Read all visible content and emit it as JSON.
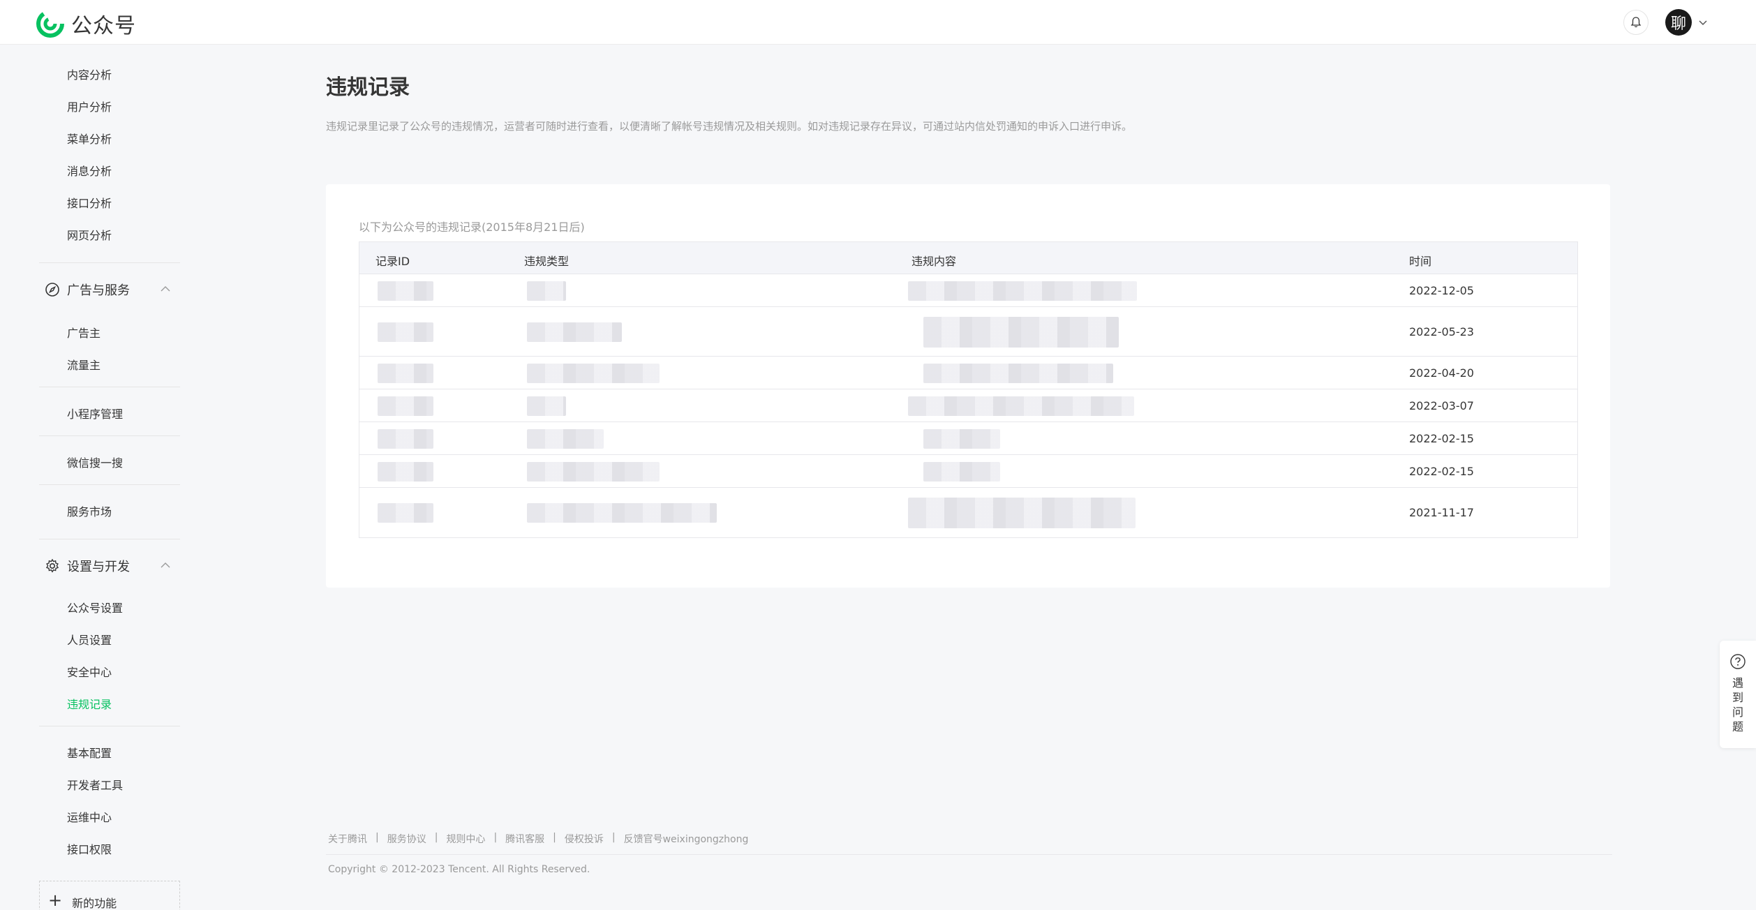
{
  "header": {
    "logo_text": "公众号",
    "brand_color": "#07c160",
    "avatar_char": "聊"
  },
  "sidebar": {
    "analysis_items": [
      "内容分析",
      "用户分析",
      "菜单分析",
      "消息分析",
      "接口分析",
      "网页分析"
    ],
    "ads_group": {
      "title": "广告与服务",
      "items": [
        "广告主",
        "流量主"
      ]
    },
    "standalone": [
      "小程序管理",
      "微信搜一搜",
      "服务市场"
    ],
    "settings_group": {
      "title": "设置与开发",
      "items": [
        "公众号设置",
        "人员设置",
        "安全中心",
        "违规记录"
      ],
      "active": "违规记录"
    },
    "dev_items": [
      "基本配置",
      "开发者工具",
      "运维中心",
      "接口权限"
    ],
    "new_feature": "新的功能"
  },
  "main": {
    "title": "违规记录",
    "description": "违规记录里记录了公众号的违规情况，运营者可随时进行查看，以便清晰了解帐号违规情况及相关规则。如对违规记录存在异议，可通过站内信处罚通知的申诉入口进行申诉。",
    "caption": "以下为公众号的违规记录(2015年8月21日后)",
    "table": {
      "columns": [
        "记录ID",
        "违规类型",
        "违规内容",
        "时间"
      ],
      "rows": [
        {
          "time": "2022-12-05"
        },
        {
          "time": "2022-05-23"
        },
        {
          "time": "2022-04-20"
        },
        {
          "time": "2022-03-07"
        },
        {
          "time": "2022-02-15"
        },
        {
          "time": "2022-02-15"
        },
        {
          "time": "2021-11-17"
        }
      ]
    }
  },
  "footer": {
    "links": [
      "关于腾讯",
      "服务协议",
      "规则中心",
      "腾讯客服",
      "侵权投诉",
      "反馈官号weixingongzhong"
    ],
    "copyright": "Copyright © 2012-2023 Tencent. All Rights Reserved."
  },
  "help": {
    "label": "遇到问题"
  },
  "icons": {
    "logo": "wechat-official-account-logo",
    "bell": "bell-icon",
    "ads": "compass-icon",
    "settings": "gear-icon",
    "help": "question-circle-icon"
  }
}
